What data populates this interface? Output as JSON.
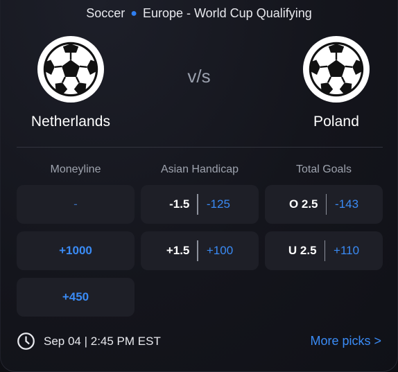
{
  "header": {
    "sport": "Soccer",
    "league": "Europe - World Cup Qualifying"
  },
  "match": {
    "home": {
      "name": "Netherlands",
      "logo_icon": "soccer-ball-icon"
    },
    "away": {
      "name": "Poland",
      "logo_icon": "soccer-ball-icon"
    },
    "versus": "v/s"
  },
  "columns": {
    "moneyline": "Moneyline",
    "asian_handicap": "Asian Handicap",
    "total_goals": "Total Goals"
  },
  "odds": {
    "moneyline": [
      "-",
      "+1000",
      "+450"
    ],
    "asian_handicap": [
      {
        "line": "-1.5",
        "odds": "-125"
      },
      {
        "line": "+1.5",
        "odds": "+100"
      }
    ],
    "total_goals": [
      {
        "line": "O 2.5",
        "odds": "-143"
      },
      {
        "line": "U 2.5",
        "odds": "+110"
      }
    ]
  },
  "footer": {
    "time": "Sep 04 | 2:45 PM EST",
    "time_icon": "clock-icon",
    "more_link": "More picks >"
  },
  "colors": {
    "accent": "#3a8bf5",
    "cell_bg": "#1e1f27",
    "background": "#14151c"
  }
}
